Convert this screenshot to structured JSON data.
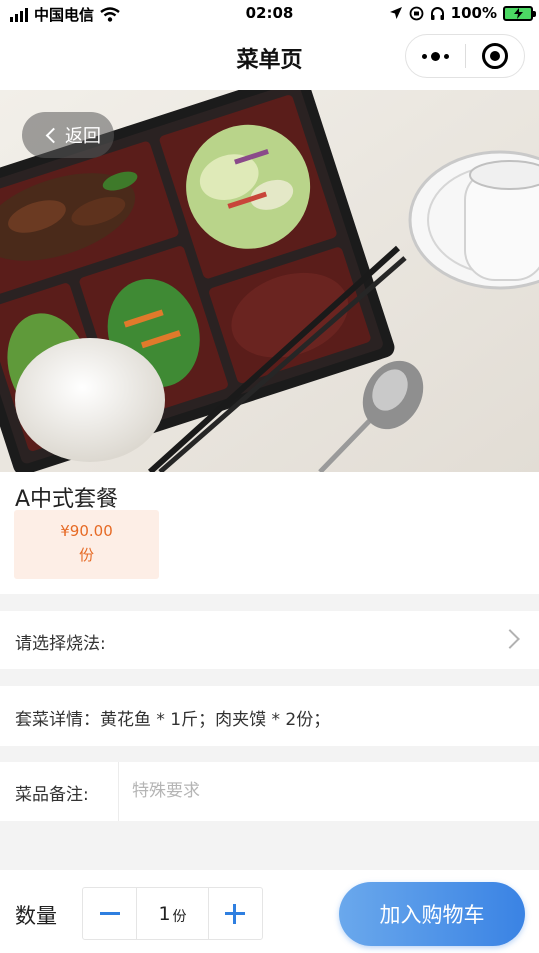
{
  "status_bar": {
    "carrier": "中国电信",
    "time": "02:08",
    "battery": "100%"
  },
  "nav": {
    "title": "菜单页"
  },
  "hero": {
    "back_label": "返回"
  },
  "product": {
    "name": "A中式套餐",
    "price": "¥90.00",
    "unit": "份"
  },
  "options": {
    "cooking_method_label": "请选择烧法:",
    "set_detail": "套菜详情：黄花鱼 * 1斤；肉夹馍 * 2份；",
    "remark_label": "菜品备注:",
    "remark_placeholder": "特殊要求",
    "remark_value": ""
  },
  "bottom": {
    "qty_label": "数量",
    "qty_value": "1",
    "qty_unit": "份",
    "cart_label": "加入购物车"
  },
  "colors": {
    "accent": "#3a83e4",
    "price_text": "#e66a25",
    "price_bg": "#fdeee6"
  }
}
